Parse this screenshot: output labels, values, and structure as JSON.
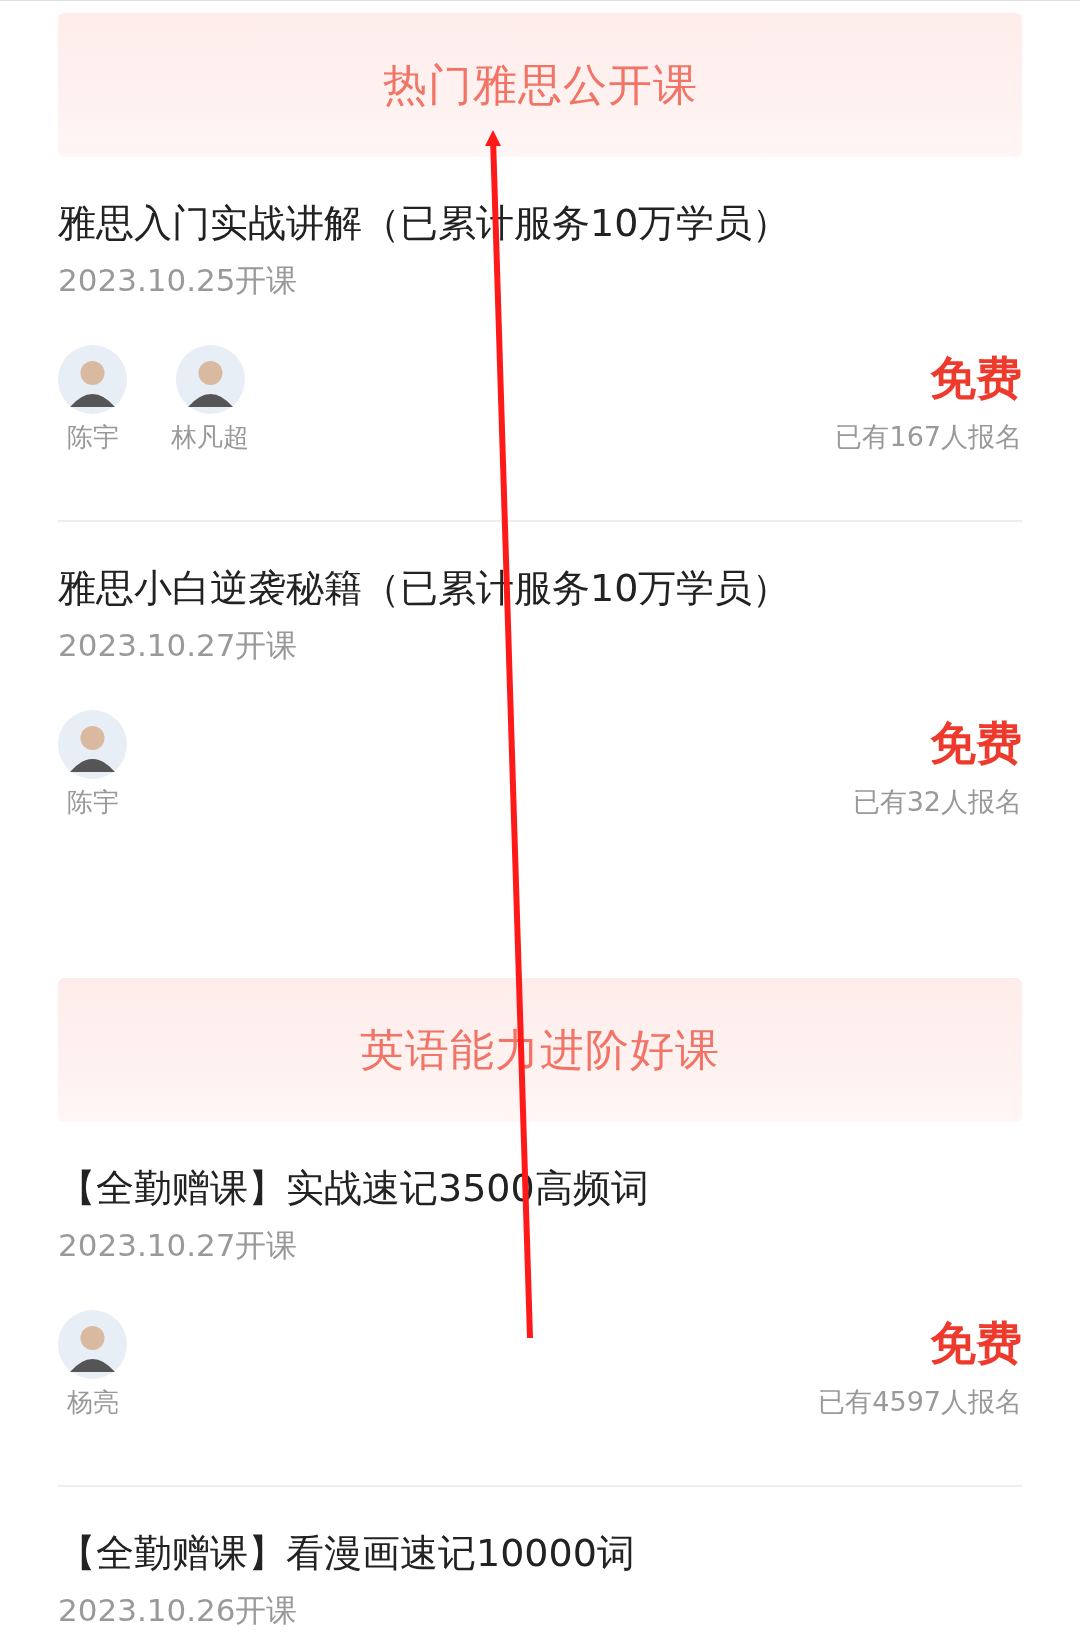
{
  "sections": [
    {
      "title": "热门雅思公开课",
      "courses": [
        {
          "title": "雅思入门实战讲解（已累计服务10万学员）",
          "date": "2023.10.25开课",
          "teachers": [
            {
              "name": "陈宇"
            },
            {
              "name": "林凡超"
            }
          ],
          "price": "免费",
          "enrolled": "已有167人报名"
        },
        {
          "title": "雅思小白逆袭秘籍（已累计服务10万学员）",
          "date": "2023.10.27开课",
          "teachers": [
            {
              "name": "陈宇"
            }
          ],
          "price": "免费",
          "enrolled": "已有32人报名"
        }
      ]
    },
    {
      "title": "英语能力进阶好课",
      "courses": [
        {
          "title": "【全勤赠课】实战速记3500高频词",
          "date": "2023.10.27开课",
          "teachers": [
            {
              "name": "杨亮"
            }
          ],
          "price": "免费",
          "enrolled": "已有4597人报名"
        },
        {
          "title": "【全勤赠课】看漫画速记10000词",
          "date": "2023.10.26开课"
        }
      ]
    }
  ]
}
